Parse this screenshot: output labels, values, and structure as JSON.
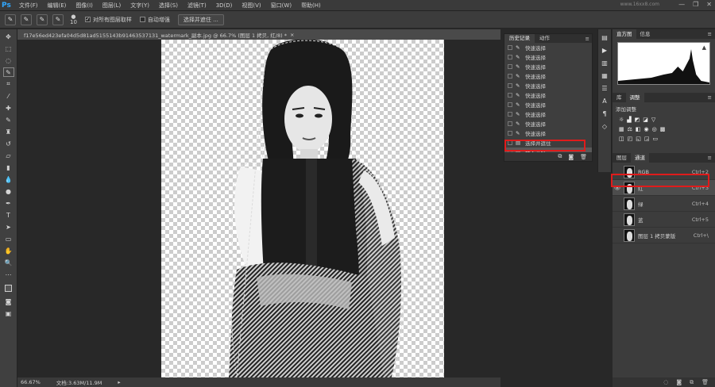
{
  "menubar": {
    "logo": "Ps",
    "items": [
      "文件(F)",
      "编辑(E)",
      "图像(I)",
      "图层(L)",
      "文字(Y)",
      "选择(S)",
      "滤镜(T)",
      "3D(D)",
      "视图(V)",
      "窗口(W)",
      "帮助(H)"
    ],
    "brand": "www.16xx8.com"
  },
  "options": {
    "brush_size": "10",
    "sample_all": "对所有图层取样",
    "auto_enhance": "自动增强",
    "select_mask": "选择并遮住 ..."
  },
  "document": {
    "tab_title": "f17e56ed423efa04d5d81ad5155143b91463537131_watermark_副本.jpg @ 66.7% (图层 1 拷贝, 红/8) *",
    "close": "×",
    "zoom": "66.67%",
    "doc_info": "文档:3.63M/11.9M"
  },
  "history_panel": {
    "tabs": [
      "历史记录",
      "动作"
    ],
    "items": [
      "快速选择",
      "快速选择",
      "快速选择",
      "快速选择",
      "快速选择",
      "快速选择",
      "快速选择",
      "快速选择",
      "快速选择",
      "快速选择",
      "选择并遮住",
      "载入选区"
    ],
    "selected_index": 11
  },
  "right_panel": {
    "top_tabs": [
      "直方图",
      "信息"
    ],
    "adj_tabs": [
      "库",
      "调整"
    ],
    "adj_title": "添加调整",
    "layer_tabs": [
      "图层",
      "通道"
    ],
    "channels": [
      {
        "name": "RGB",
        "shortcut": "Ctrl+2"
      },
      {
        "name": "红",
        "shortcut": "Ctrl+3"
      },
      {
        "name": "绿",
        "shortcut": "Ctrl+4"
      },
      {
        "name": "蓝",
        "shortcut": "Ctrl+5"
      },
      {
        "name": "图层 1 拷贝蒙版",
        "shortcut": "Ctrl+\\"
      }
    ],
    "selected_channel": 1
  },
  "colors": {
    "highlight_red": "#e01b1b",
    "accent": "#31a8ff"
  }
}
